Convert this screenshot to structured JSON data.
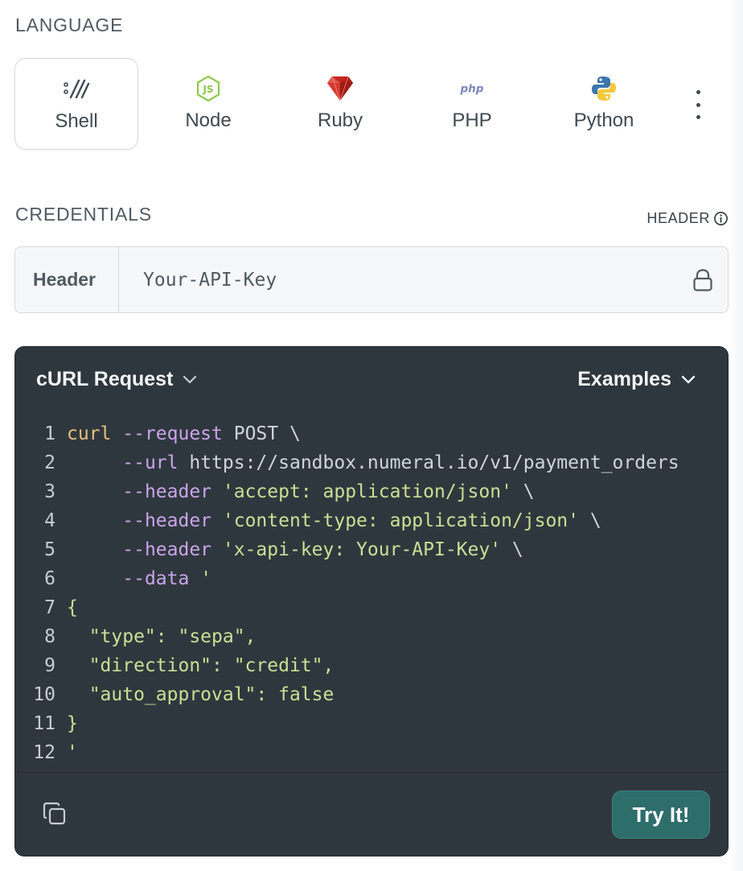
{
  "language": {
    "title": "LANGUAGE",
    "tabs": [
      {
        "label": "Shell",
        "icon": "shell-icon",
        "active": true
      },
      {
        "label": "Node",
        "icon": "nodejs-icon",
        "active": false
      },
      {
        "label": "Ruby",
        "icon": "ruby-icon",
        "active": false
      },
      {
        "label": "PHP",
        "icon": "php-icon",
        "icon_text": "php",
        "active": false
      },
      {
        "label": "Python",
        "icon": "python-icon",
        "active": false
      }
    ],
    "more_icon": "more-vertical-icon"
  },
  "credentials": {
    "title": "CREDENTIALS",
    "header_badge": "HEADER",
    "field_label": "Header",
    "field_placeholder": "Your-API-Key",
    "lock_icon": "lock-icon"
  },
  "code": {
    "request_dropdown": "cURL Request",
    "examples_dropdown": "Examples",
    "lines": [
      {
        "n": "1",
        "parts": [
          [
            "cmd",
            "curl"
          ],
          [
            "plain",
            " "
          ],
          [
            "flag",
            "--request"
          ],
          [
            "plain",
            " POST \\"
          ]
        ]
      },
      {
        "n": "2",
        "parts": [
          [
            "plain",
            "     "
          ],
          [
            "flag",
            "--url"
          ],
          [
            "plain",
            " https://sandbox.numeral.io/v1/payment_orders"
          ]
        ]
      },
      {
        "n": "3",
        "parts": [
          [
            "plain",
            "     "
          ],
          [
            "flag",
            "--header"
          ],
          [
            "plain",
            " "
          ],
          [
            "str",
            "'accept: application/json'"
          ],
          [
            "plain",
            " \\"
          ]
        ]
      },
      {
        "n": "4",
        "parts": [
          [
            "plain",
            "     "
          ],
          [
            "flag",
            "--header"
          ],
          [
            "plain",
            " "
          ],
          [
            "str",
            "'content-type: application/json'"
          ],
          [
            "plain",
            " \\"
          ]
        ]
      },
      {
        "n": "5",
        "parts": [
          [
            "plain",
            "     "
          ],
          [
            "flag",
            "--header"
          ],
          [
            "plain",
            " "
          ],
          [
            "str",
            "'x-api-key: Your-API-Key'"
          ],
          [
            "plain",
            " \\"
          ]
        ]
      },
      {
        "n": "6",
        "parts": [
          [
            "plain",
            "     "
          ],
          [
            "flag",
            "--data"
          ],
          [
            "plain",
            " "
          ],
          [
            "str",
            "'"
          ]
        ]
      },
      {
        "n": "7",
        "parts": [
          [
            "str",
            "{"
          ]
        ]
      },
      {
        "n": "8",
        "parts": [
          [
            "str",
            "  \"type\": \"sepa\","
          ]
        ]
      },
      {
        "n": "9",
        "parts": [
          [
            "str",
            "  \"direction\": \"credit\","
          ]
        ]
      },
      {
        "n": "10",
        "parts": [
          [
            "str",
            "  \"auto_approval\": false"
          ]
        ]
      },
      {
        "n": "11",
        "parts": [
          [
            "str",
            "}"
          ]
        ]
      },
      {
        "n": "12",
        "parts": [
          [
            "str",
            "'"
          ]
        ]
      }
    ],
    "copy_icon": "copy-icon",
    "try_label": "Try It!"
  },
  "colors": {
    "code_bg": "#2f373e",
    "accent_button": "#2d6d6a",
    "string": "#c8e095",
    "flag": "#c9a5e8",
    "command": "#e5c07b"
  }
}
